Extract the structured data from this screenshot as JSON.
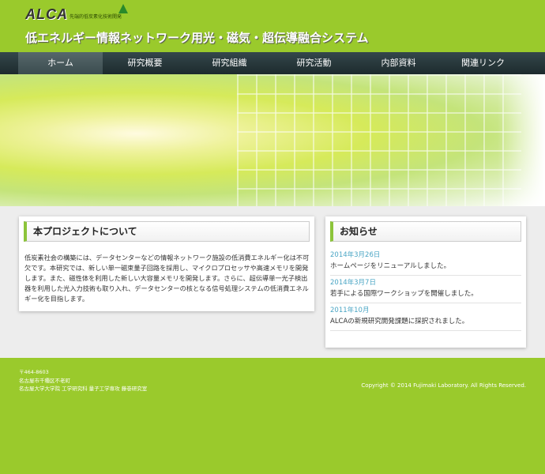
{
  "header": {
    "logo": "ALCA",
    "tagline": "先端的低炭素化技術開発",
    "site_title": "低エネルギー情報ネットワーク用光・磁気・超伝導融合システム"
  },
  "nav": {
    "items": [
      {
        "label": "ホーム",
        "active": true
      },
      {
        "label": "研究概要"
      },
      {
        "label": "研究組織"
      },
      {
        "label": "研究活動"
      },
      {
        "label": "内部資料"
      },
      {
        "label": "関連リンク"
      }
    ]
  },
  "about": {
    "heading": "本プロジェクトについて",
    "text": "低炭素社会の構築には、データセンターなどの情報ネットワーク施設の低消費エネルギー化は不可欠です。本研究では、新しい単一磁束量子回路を採用し、マイクロプロセッサや高速メモリを開発します。また、磁性体を利用した新しい大容量メモリを開発します。さらに、超伝導単一光子検出器を利用した光入力技術も取り入れ、データセンターの核となる信号処理システムの低消費エネルギー化を目指します。"
  },
  "news": {
    "heading": "お知らせ",
    "items": [
      {
        "date": "2014年3月26日",
        "text": "ホームページをリニューアルしました。"
      },
      {
        "date": "2014年3月7日",
        "text": "若手による国際ワークショップを開催しました。"
      },
      {
        "date": "2011年10月",
        "text": "ALCAの新規研究開発課題に採択されました。"
      }
    ]
  },
  "footer": {
    "postal": "〒464-8603",
    "address": "名古屋市千種区不老町",
    "org": "名古屋大学大学院 工学研究科 量子工学専攻 藤巻研究室",
    "copyright": "Copyright © 2014 Fujimaki Laboratory. All Rights Reserved."
  },
  "colors": {
    "brand_green": "#9aca2c",
    "nav_dark": "#1d2a2d",
    "date_blue": "#4aa5c4"
  }
}
